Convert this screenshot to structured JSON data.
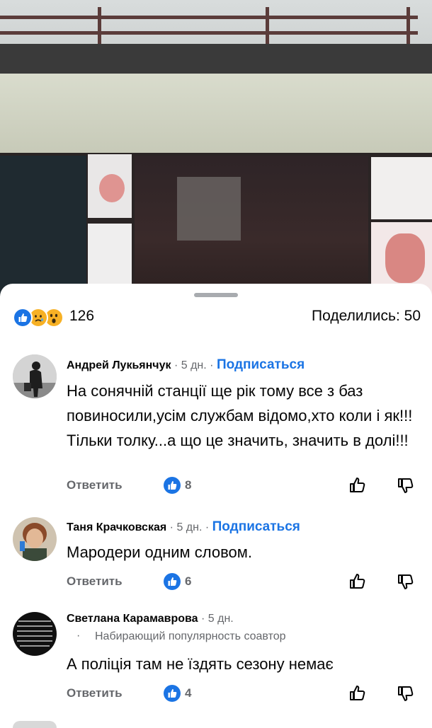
{
  "post": {
    "reaction_icons": [
      "like-icon",
      "sad-icon",
      "wow-icon"
    ],
    "reaction_count": "126",
    "shares_label": "Поделились: 50"
  },
  "comments": [
    {
      "author": "Андрей Лукьянчук",
      "time": "5 дн.",
      "subscribe": "Подписаться",
      "badge": "",
      "text": "На сонячній станції ще рік тому все з баз повиносили,усім службам відомо,хто коли і як!!! Тільки толку...а що це значить, значить в долі!!!",
      "reply_label": "Ответить",
      "likes": "8"
    },
    {
      "author": "Таня Крачковская",
      "time": "5 дн.",
      "subscribe": "Подписаться",
      "badge": "",
      "text": "Мародери одним словом.",
      "reply_label": "Ответить",
      "likes": "6"
    },
    {
      "author": "Светлана Карамаврова",
      "time": "5 дн.",
      "subscribe": "",
      "badge": "Набирающий популярность соавтор",
      "text": "А поліція там не їздять сезону немає",
      "reply_label": "Ответить",
      "likes": "4"
    }
  ],
  "colors": {
    "accent": "#1b74e4",
    "muted": "#65676b",
    "text": "#050505"
  }
}
